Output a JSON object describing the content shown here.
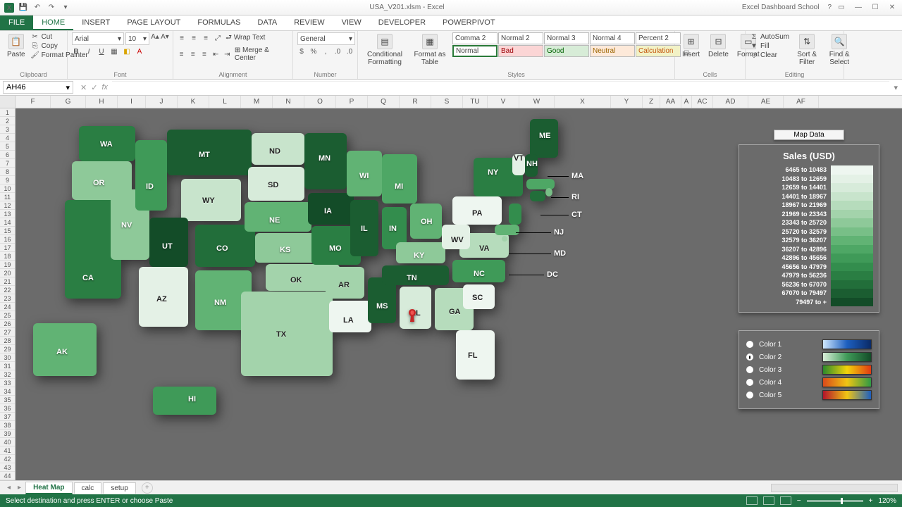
{
  "app": {
    "title": "USA_V201.xlsm - Excel",
    "account": "Excel Dashboard School"
  },
  "tabs": {
    "file": "FILE",
    "items": [
      "HOME",
      "INSERT",
      "PAGE LAYOUT",
      "FORMULAS",
      "DATA",
      "REVIEW",
      "VIEW",
      "DEVELOPER",
      "POWERPIVOT"
    ],
    "active": "HOME"
  },
  "ribbon": {
    "clipboard": {
      "label": "Clipboard",
      "paste": "Paste",
      "cut": "Cut",
      "copy": "Copy",
      "painter": "Format Painter"
    },
    "font": {
      "label": "Font",
      "name": "Arial",
      "size": "10"
    },
    "alignment": {
      "label": "Alignment",
      "wrap": "Wrap Text",
      "merge": "Merge & Center"
    },
    "number": {
      "label": "Number",
      "format": "General"
    },
    "styles": {
      "label": "Styles",
      "cond": "Conditional Formatting",
      "table": "Format as Table",
      "cells": [
        "Comma 2",
        "Normal 2",
        "Normal 3",
        "Normal 4",
        "Percent 2",
        "Normal",
        "Bad",
        "Good",
        "Neutral",
        "Calculation"
      ]
    },
    "cells": {
      "label": "Cells",
      "insert": "Insert",
      "delete": "Delete",
      "format": "Format"
    },
    "editing": {
      "label": "Editing",
      "sum": "AutoSum",
      "fill": "Fill",
      "clear": "Clear",
      "sort": "Sort & Filter",
      "find": "Find & Select"
    }
  },
  "formula": {
    "namebox": "AH46",
    "value": ""
  },
  "columns": [
    "F",
    "G",
    "H",
    "I",
    "J",
    "K",
    "L",
    "M",
    "N",
    "O",
    "P",
    "Q",
    "R",
    "S",
    "TU",
    "V",
    "W",
    "X",
    "Y",
    "Z",
    "AA",
    "A",
    "AC",
    "AD",
    "AE",
    "AF"
  ],
  "rows_start": 1,
  "rows_end": 44,
  "legend": {
    "button": "Map Data",
    "title": "Sales (USD)",
    "ranges": [
      "6465 to 10483",
      "10483 to 12659",
      "12659 to 14401",
      "14401 to 18967",
      "18967 to 21969",
      "21969 to 23343",
      "23343 to 25720",
      "25720 to 32579",
      "32579 to 36207",
      "36207 to 42896",
      "42896 to 45656",
      "45656 to 47979",
      "47979 to 56236",
      "56236 to 67070",
      "67070 to 79497",
      "79497 to +"
    ],
    "colors": [
      "#eef6f0",
      "#e4f1e6",
      "#d7ebda",
      "#c8e4cc",
      "#b6dcbc",
      "#a3d3ab",
      "#8ec999",
      "#78bf87",
      "#61b374",
      "#4ea765",
      "#3f9a58",
      "#338d4d",
      "#2a7e43",
      "#226e3a",
      "#1b5d31",
      "#134c28"
    ]
  },
  "color_options": [
    {
      "label": "Color 1",
      "grad": "linear-gradient(90deg,#cfe8ff,#1d5fbf,#0a2a66)"
    },
    {
      "label": "Color 2",
      "grad": "linear-gradient(90deg,#d9efd9,#3f9a58,#134c28)",
      "selected": true
    },
    {
      "label": "Color 3",
      "grad": "linear-gradient(90deg,#2b8a2b,#f2d40a,#e23a12)"
    },
    {
      "label": "Color 4",
      "grad": "linear-gradient(90deg,#d94a1a,#f0c514,#2f9a44)"
    },
    {
      "label": "Color 5",
      "grad": "linear-gradient(90deg,#b3142a,#f0c514,#1d5fbf)"
    }
  ],
  "states": {
    "WA": "WA",
    "OR": "OR",
    "CA": "CA",
    "NV": "NV",
    "ID": "ID",
    "MT": "MT",
    "WY": "WY",
    "UT": "UT",
    "AZ": "AZ",
    "CO": "CO",
    "NM": "NM",
    "ND": "ND",
    "SD": "SD",
    "NE": "NE",
    "KS": "KS",
    "OK": "OK",
    "TX": "TX",
    "MN": "MN",
    "IA": "IA",
    "MO": "MO",
    "AR": "AR",
    "LA": "LA",
    "WI": "WI",
    "IL": "IL",
    "MS": "MS",
    "MI": "MI",
    "IN": "IN",
    "OH": "OH",
    "KY": "KY",
    "TN": "TN",
    "AL": "AL",
    "GA": "GA",
    "FL": "FL",
    "SC": "SC",
    "NC": "NC",
    "VA": "VA",
    "WV": "WV",
    "PA": "PA",
    "NY": "NY",
    "ME": "ME",
    "AK": "AK",
    "HI": "HI",
    "VT": "VT",
    "NH": "NH",
    "MA": "MA",
    "RI": "RI",
    "CT": "CT",
    "NJ": "NJ",
    "MD": "MD",
    "DC": "DC"
  },
  "sheet_tabs": {
    "items": [
      "Heat Map",
      "calc",
      "setup"
    ],
    "active": "Heat Map"
  },
  "status": {
    "msg": "Select destination and press ENTER or choose Paste",
    "zoom": "120%"
  },
  "chart_data": {
    "type": "heatmap",
    "title": "Sales (USD)",
    "geography": "US States",
    "color_scale": "green sequential (light→dark = low→high)",
    "bins": [
      {
        "range": [
          6465,
          10483
        ],
        "color": "#eef6f0"
      },
      {
        "range": [
          10483,
          12659
        ],
        "color": "#e4f1e6"
      },
      {
        "range": [
          12659,
          14401
        ],
        "color": "#d7ebda"
      },
      {
        "range": [
          14401,
          18967
        ],
        "color": "#c8e4cc"
      },
      {
        "range": [
          18967,
          21969
        ],
        "color": "#b6dcbc"
      },
      {
        "range": [
          21969,
          23343
        ],
        "color": "#a3d3ab"
      },
      {
        "range": [
          23343,
          25720
        ],
        "color": "#8ec999"
      },
      {
        "range": [
          25720,
          32579
        ],
        "color": "#78bf87"
      },
      {
        "range": [
          32579,
          36207
        ],
        "color": "#61b374"
      },
      {
        "range": [
          36207,
          42896
        ],
        "color": "#4ea765"
      },
      {
        "range": [
          42896,
          45656
        ],
        "color": "#3f9a58"
      },
      {
        "range": [
          45656,
          47979
        ],
        "color": "#338d4d"
      },
      {
        "range": [
          47979,
          56236
        ],
        "color": "#2a7e43"
      },
      {
        "range": [
          56236,
          67070
        ],
        "color": "#226e3a"
      },
      {
        "range": [
          67070,
          79497
        ],
        "color": "#1b5d31"
      },
      {
        "range": [
          79497,
          null
        ],
        "color": "#134c28"
      }
    ],
    "series": [
      {
        "state": "WA",
        "bin": 12
      },
      {
        "state": "OR",
        "bin": 6
      },
      {
        "state": "CA",
        "bin": 12
      },
      {
        "state": "NV",
        "bin": 6
      },
      {
        "state": "ID",
        "bin": 10
      },
      {
        "state": "MT",
        "bin": 14
      },
      {
        "state": "WY",
        "bin": 3
      },
      {
        "state": "UT",
        "bin": 15
      },
      {
        "state": "AZ",
        "bin": 1
      },
      {
        "state": "CO",
        "bin": 13
      },
      {
        "state": "NM",
        "bin": 8
      },
      {
        "state": "ND",
        "bin": 3
      },
      {
        "state": "SD",
        "bin": 2
      },
      {
        "state": "NE",
        "bin": 8
      },
      {
        "state": "KS",
        "bin": 6
      },
      {
        "state": "OK",
        "bin": 5
      },
      {
        "state": "TX",
        "bin": 5
      },
      {
        "state": "MN",
        "bin": 14
      },
      {
        "state": "IA",
        "bin": 15
      },
      {
        "state": "MO",
        "bin": 12
      },
      {
        "state": "AR",
        "bin": 5
      },
      {
        "state": "LA",
        "bin": 0
      },
      {
        "state": "WI",
        "bin": 8
      },
      {
        "state": "IL",
        "bin": 14
      },
      {
        "state": "MS",
        "bin": 14
      },
      {
        "state": "MI",
        "bin": 9
      },
      {
        "state": "IN",
        "bin": 11
      },
      {
        "state": "OH",
        "bin": 8
      },
      {
        "state": "KY",
        "bin": 6
      },
      {
        "state": "TN",
        "bin": 14
      },
      {
        "state": "AL",
        "bin": 2
      },
      {
        "state": "GA",
        "bin": 4
      },
      {
        "state": "FL",
        "bin": 0
      },
      {
        "state": "SC",
        "bin": 0
      },
      {
        "state": "NC",
        "bin": 10
      },
      {
        "state": "VA",
        "bin": 4
      },
      {
        "state": "WV",
        "bin": 1
      },
      {
        "state": "PA",
        "bin": 0
      },
      {
        "state": "NY",
        "bin": 12
      },
      {
        "state": "ME",
        "bin": 14
      },
      {
        "state": "VT",
        "bin": 1
      },
      {
        "state": "NH",
        "bin": 14
      },
      {
        "state": "MA",
        "bin": 9
      },
      {
        "state": "RI",
        "bin": 7
      },
      {
        "state": "CT",
        "bin": 13
      },
      {
        "state": "NJ",
        "bin": 11
      },
      {
        "state": "MD",
        "bin": 8
      },
      {
        "state": "DC",
        "bin": 5
      },
      {
        "state": "AK",
        "bin": 8
      },
      {
        "state": "HI",
        "bin": 10
      }
    ],
    "highlighted_state": "AL"
  }
}
